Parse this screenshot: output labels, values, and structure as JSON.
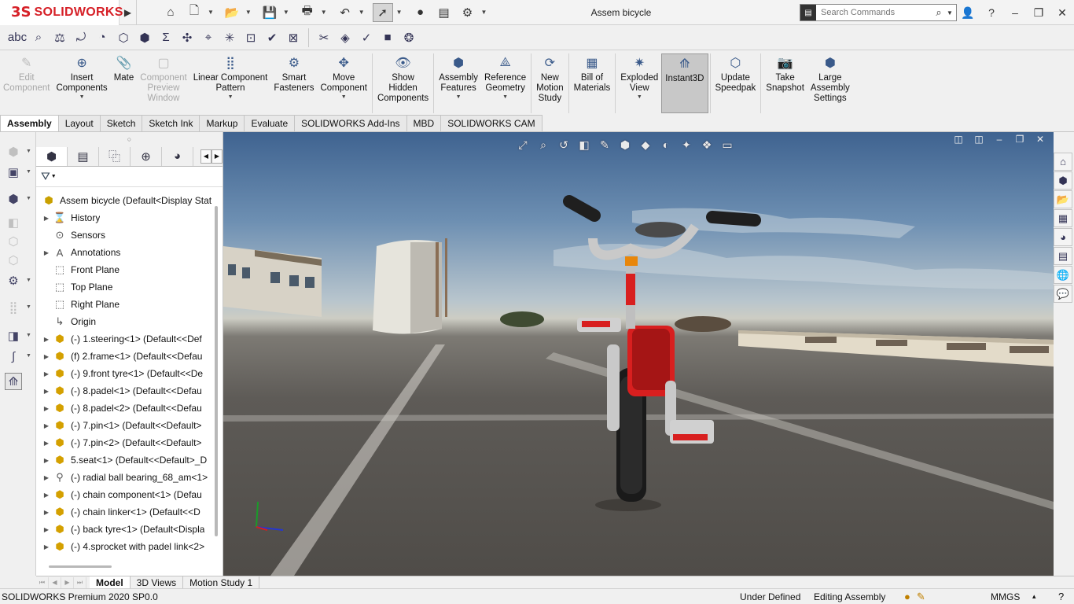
{
  "app": {
    "brand_prefix": "3S",
    "brand": "SOLIDWORKS",
    "doc_title": "Assem bicycle",
    "search_placeholder": "Search Commands",
    "window_controls": [
      "–",
      "❐",
      "✕"
    ]
  },
  "quick_access": [
    {
      "name": "home-icon",
      "glyph": "⌂",
      "dd": false
    },
    {
      "name": "new-document-icon",
      "glyph": "🗋",
      "dd": true
    },
    {
      "name": "open-folder-icon",
      "glyph": "📂",
      "dd": true
    },
    {
      "name": "save-icon",
      "glyph": "💾",
      "dd": true
    },
    {
      "name": "print-icon",
      "glyph": "🖶",
      "dd": true
    },
    {
      "name": "undo-icon",
      "glyph": "↶",
      "dd": true
    },
    {
      "name": "select-pointer-icon",
      "glyph": "➚",
      "dd": true,
      "active": true
    },
    {
      "name": "traffic-light-icon",
      "glyph": "●",
      "dd": false
    },
    {
      "name": "file-properties-icon",
      "glyph": "▤",
      "dd": false
    },
    {
      "name": "options-gear-icon",
      "glyph": "⚙",
      "dd": true
    }
  ],
  "toolbar2": [
    "abc",
    "⌕",
    "⚖",
    "⤾",
    "◔",
    "⬡",
    "⬢",
    "Σ",
    "✣",
    "⌖",
    "✳",
    "⊡",
    "✔",
    "⊠",
    "|",
    "✂",
    "◈",
    "✓",
    "■",
    "❂"
  ],
  "commands": [
    {
      "label": "Edit\nComponent",
      "icon": "✎",
      "disabled": true,
      "dd": false
    },
    {
      "label": "Insert\nComponents",
      "icon": "⊕",
      "disabled": false,
      "dd": true
    },
    {
      "label": "Mate",
      "icon": "📎",
      "disabled": false,
      "dd": false
    },
    {
      "label": "Component\nPreview\nWindow",
      "icon": "▢",
      "disabled": true,
      "dd": false
    },
    {
      "label": "Linear Component\nPattern",
      "icon": "⣿",
      "disabled": false,
      "dd": true
    },
    {
      "label": "Smart\nFasteners",
      "icon": "⚙",
      "disabled": false,
      "dd": false
    },
    {
      "label": "Move\nComponent",
      "icon": "✥",
      "disabled": false,
      "dd": true
    },
    {
      "sep": true
    },
    {
      "label": "Show\nHidden\nComponents",
      "icon": "👁",
      "disabled": false,
      "dd": false
    },
    {
      "sep": true
    },
    {
      "label": "Assembly\nFeatures",
      "icon": "⬢",
      "disabled": false,
      "dd": true
    },
    {
      "label": "Reference\nGeometry",
      "icon": "⟁",
      "disabled": false,
      "dd": true
    },
    {
      "sep": true
    },
    {
      "label": "New\nMotion\nStudy",
      "icon": "⟳",
      "disabled": false,
      "dd": false
    },
    {
      "sep": true
    },
    {
      "label": "Bill of\nMaterials",
      "icon": "▦",
      "disabled": false,
      "dd": false
    },
    {
      "sep": true
    },
    {
      "label": "Exploded\nView",
      "icon": "✷",
      "disabled": false,
      "dd": true
    },
    {
      "label": "Instant3D",
      "icon": "⟰",
      "disabled": false,
      "dd": false,
      "active": true
    },
    {
      "sep": true
    },
    {
      "label": "Update\nSpeedpak",
      "icon": "⬡",
      "disabled": false,
      "dd": false
    },
    {
      "sep": true
    },
    {
      "label": "Take\nSnapshot",
      "icon": "📷",
      "disabled": false,
      "dd": false
    },
    {
      "label": "Large\nAssembly\nSettings",
      "icon": "⬢",
      "disabled": false,
      "dd": false
    }
  ],
  "cm_tabs": [
    "Assembly",
    "Layout",
    "Sketch",
    "Sketch Ink",
    "Markup",
    "Evaluate",
    "SOLIDWORKS Add-Ins",
    "MBD",
    "SOLIDWORKS CAM"
  ],
  "active_cm_tab": 0,
  "fm_tabs": [
    {
      "name": "featuremanager-tab",
      "glyph": "⬢"
    },
    {
      "name": "propertymanager-tab",
      "glyph": "▤"
    },
    {
      "name": "configurationmanager-tab",
      "glyph": "⿻"
    },
    {
      "name": "dimxpert-tab",
      "glyph": "⊕"
    },
    {
      "name": "display-manager-tab",
      "glyph": "◕"
    }
  ],
  "tree": [
    {
      "label": "Assem bicycle  (Default<Display Stat",
      "icon": "root",
      "expander": false,
      "root": true
    },
    {
      "label": "History",
      "icon": "history",
      "expander": true
    },
    {
      "label": "Sensors",
      "icon": "sensor",
      "expander": false
    },
    {
      "label": "Annotations",
      "icon": "annotation",
      "expander": true
    },
    {
      "label": "Front Plane",
      "icon": "plane",
      "expander": false
    },
    {
      "label": "Top Plane",
      "icon": "plane",
      "expander": false
    },
    {
      "label": "Right Plane",
      "icon": "plane",
      "expander": false
    },
    {
      "label": "Origin",
      "icon": "origin",
      "expander": false
    },
    {
      "label": "(-) 1.steering<1> (Default<<Def",
      "icon": "part",
      "expander": true
    },
    {
      "label": "(f) 2.frame<1> (Default<<Defau",
      "icon": "part",
      "expander": true
    },
    {
      "label": "(-) 9.front tyre<1> (Default<<De",
      "icon": "part",
      "expander": true
    },
    {
      "label": "(-) 8.padel<1> (Default<<Defau",
      "icon": "part",
      "expander": true
    },
    {
      "label": "(-) 8.padel<2> (Default<<Defau",
      "icon": "part",
      "expander": true
    },
    {
      "label": "(-) 7.pin<1> (Default<<Default>",
      "icon": "part",
      "expander": true
    },
    {
      "label": "(-) 7.pin<2> (Default<<Default>",
      "icon": "part",
      "expander": true
    },
    {
      "label": "5.seat<1> (Default<<Default>_D",
      "icon": "part",
      "expander": true
    },
    {
      "label": "(-) radial ball bearing_68_am<1>",
      "icon": "bearing",
      "expander": true
    },
    {
      "label": "(-) chain component<1> (Defau",
      "icon": "part",
      "expander": true
    },
    {
      "label": "(-) chain linker<1> (Default<<D",
      "icon": "part",
      "expander": true
    },
    {
      "label": "(-) back tyre<1> (Default<Displa",
      "icon": "part",
      "expander": true
    },
    {
      "label": "(-) 4.sprocket with padel link<2>",
      "icon": "part",
      "expander": true
    }
  ],
  "model_tabs": [
    "Model",
    "3D Views",
    "Motion Study 1"
  ],
  "active_model_tab": 0,
  "status": {
    "product": "SOLIDWORKS Premium 2020 SP0.0",
    "definition": "Under Defined",
    "mode": "Editing Assembly",
    "units": "MMGS",
    "caret": "▴",
    "help": "?"
  },
  "colors": {
    "brand_red": "#d62027",
    "part_yellow": "#d4a000",
    "bike_frame_red": "#d81f1f"
  }
}
